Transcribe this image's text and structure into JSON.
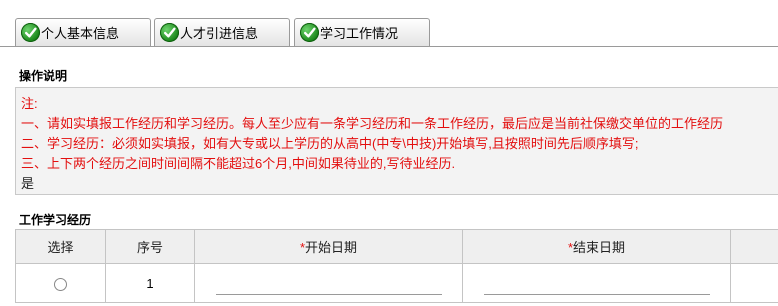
{
  "tabs": [
    {
      "label": "个人基本信息"
    },
    {
      "label": "人才引进信息"
    },
    {
      "label": "学习工作情况"
    }
  ],
  "instructions": {
    "title": "操作说明",
    "lines": [
      "注:",
      "一、请如实填报工作经历和学习经历。每人至少应有一条学习经历和一条工作经历，最后应是当前社保缴交单位的工作经历",
      "二、学习经历：必须如实填报，如有大专或以上学历的从高中(中专\\中技)开始填写,且按照时间先后顺序填写;",
      "三、上下两个经历之间时间间隔不能超过6个月,中间如果待业的,写待业经历."
    ],
    "last_line": "是"
  },
  "experience": {
    "title": "工作学习经历",
    "columns": {
      "select": "选择",
      "index": "序号",
      "required_mark": "*",
      "start_date": "开始日期",
      "end_date": "结束日期"
    },
    "rows": [
      {
        "index": "1",
        "start_date": "",
        "end_date": ""
      }
    ]
  },
  "colors": {
    "note_red": "#e30f0f",
    "tab_check_green": "#178417",
    "header_bg": "#efefef"
  }
}
